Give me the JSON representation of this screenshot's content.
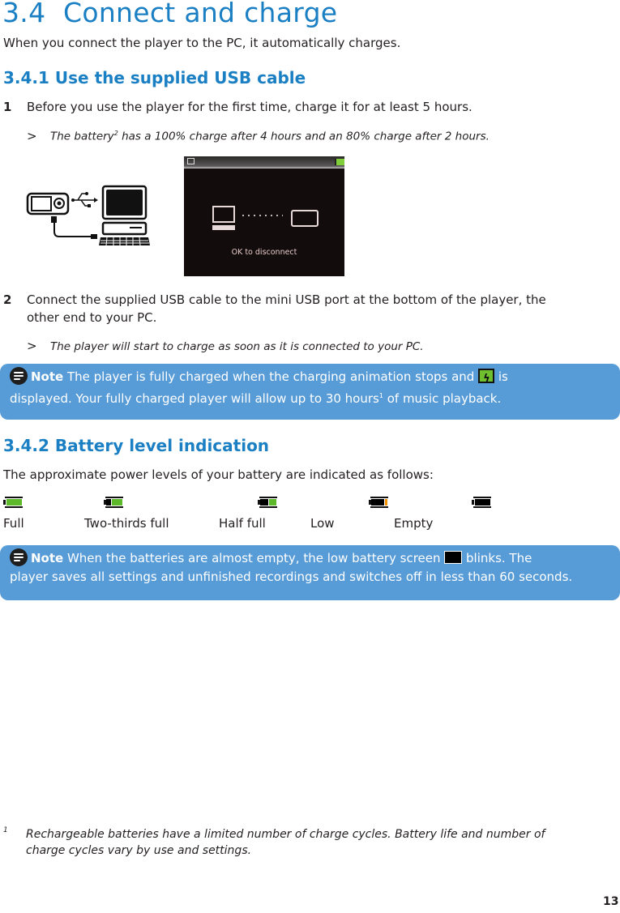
{
  "section": {
    "number": "3.4",
    "title": "Connect and charge",
    "intro": "When you connect the player to the PC, it automatically charges."
  },
  "sub1": {
    "heading": "3.4.1 Use the supplied USB cable",
    "steps": [
      {
        "num": "1",
        "text": "Before you use the player for the first time, charge it for at least 5 hours.",
        "result_a": "The battery",
        "result_sup": "2",
        "result_b": " has a 100% charge after 4 hours and an 80% charge after 2 hours."
      },
      {
        "num": "2",
        "text_line1": "Connect the supplied USB cable to the mini USB port at the bottom of the player, the",
        "text_line2": "other end to your PC.",
        "result": "The player will start to charge as soon as it is connected to your PC."
      }
    ],
    "result_marker": ">",
    "screen_caption": "OK to disconnect"
  },
  "note1": {
    "label": "Note",
    "text_a": " The player is fully charged when the charging animation stops and ",
    "text_b": " is",
    "line2_a": "displayed. Your fully charged player will allow up to 30 hours",
    "line2_sup": "1",
    "line2_b": " of music playback."
  },
  "sub2": {
    "heading": "3.4.2 Battery level indication",
    "intro": "The approximate power levels of your battery are indicated as follows:",
    "levels": [
      {
        "label": "Full",
        "fill": 1.0,
        "color": "#5db82a"
      },
      {
        "label": "Two-thirds full",
        "fill": 0.67,
        "color": "#5db82a"
      },
      {
        "label": "Half full",
        "fill": 0.5,
        "color": "#5db82a"
      },
      {
        "label": "Low",
        "fill": 0.15,
        "color": "#f39200"
      },
      {
        "label": "Empty",
        "fill": 0.0,
        "color": "#000000"
      }
    ]
  },
  "note2": {
    "label": "Note",
    "text_a": " When the batteries are almost empty, the low battery screen ",
    "text_b": " blinks. The",
    "line2": "player saves all settings and unfinished recordings and switches off in less than 60 seconds."
  },
  "footnote": {
    "marker": "1",
    "line1": "Rechargeable batteries have a limited number of charge cycles. Battery life and number of",
    "line2": "charge cycles vary by use and settings."
  },
  "page_number": "13",
  "colors": {
    "heading": "#1b7fc4",
    "note_bg": "#579bd7"
  }
}
